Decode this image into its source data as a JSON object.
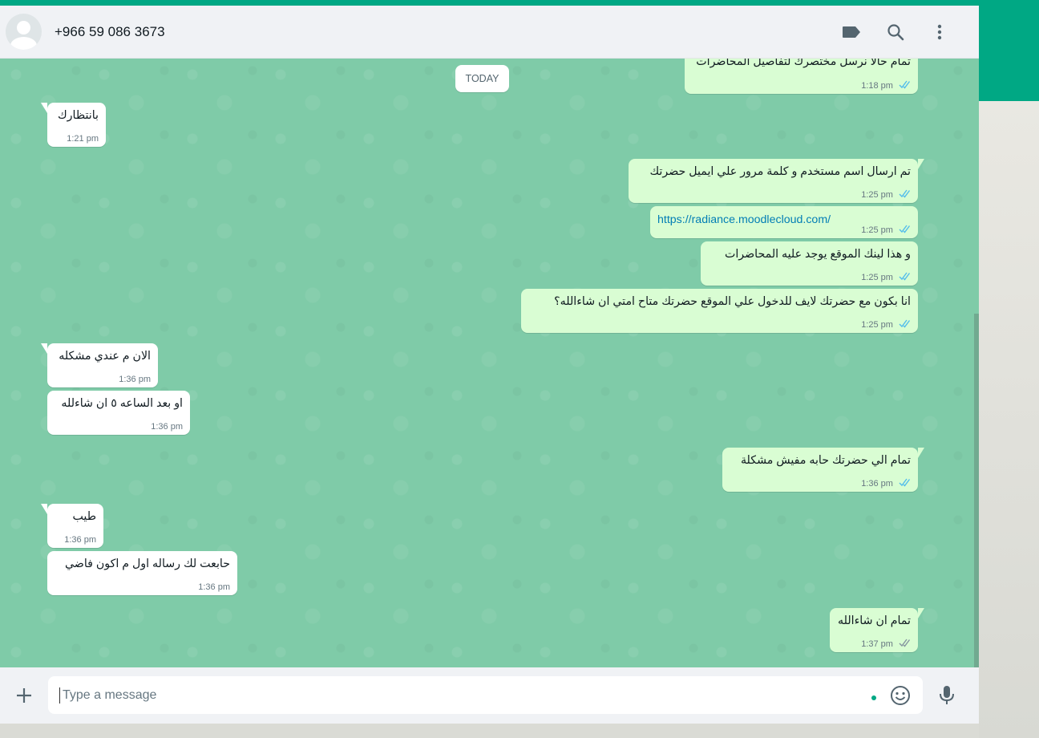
{
  "header": {
    "contact_name": "+966 59 086 3673",
    "icons": [
      "label-icon",
      "search-icon",
      "menu-icon"
    ]
  },
  "chat": {
    "partial_top_message": {
      "text": "تمام حالا نرسل مختصرك لتفاصيل المحاضرات",
      "time": "1:18 pm"
    },
    "date_divider": "TODAY",
    "messages": [
      {
        "dir": "in",
        "text": "بانتظارك",
        "time": "1:21 pm"
      },
      {
        "dir": "out",
        "text": "تم ارسال اسم مستخدم و كلمة مرور علي ايميل حضرتك",
        "time": "1:25 pm"
      },
      {
        "dir": "out",
        "text": "https://radiance.moodlecloud.com/",
        "time": "1:25 pm",
        "is_link": true
      },
      {
        "dir": "out",
        "text": "و هذا لينك الموقع يوجد عليه المحاضرات",
        "time": "1:25 pm"
      },
      {
        "dir": "out",
        "text": "انا بكون مع حضرتك لايف للدخول علي الموقع حضرتك متاح امتي ان شاءالله؟",
        "time": "1:25 pm"
      },
      {
        "dir": "in",
        "text": "الان م عندي مشكله",
        "time": "1:36 pm"
      },
      {
        "dir": "in",
        "text": "او بعد الساعه ٥ ان شاءلله",
        "time": "1:36 pm"
      },
      {
        "dir": "out",
        "text": "تمام الي حضرتك حابه مفيش مشكلة",
        "time": "1:36 pm"
      },
      {
        "dir": "in",
        "text": "طيب",
        "time": "1:36 pm"
      },
      {
        "dir": "in",
        "text": "حابعت لك رساله اول م اكون فاضي",
        "time": "1:36 pm"
      },
      {
        "dir": "out",
        "text": "تمام ان شاءالله",
        "time": "1:37 pm"
      }
    ]
  },
  "footer": {
    "placeholder": "Type a message",
    "icons": [
      "plus-icon",
      "emoji-icon",
      "mic-icon"
    ]
  },
  "colors": {
    "brand": "#00a884",
    "outgoing_bubble": "#d9fdd3",
    "incoming_bubble": "#ffffff",
    "chat_background": "#7fcba8",
    "read_ticks": "#53bdeb",
    "link": "#027eb5"
  }
}
